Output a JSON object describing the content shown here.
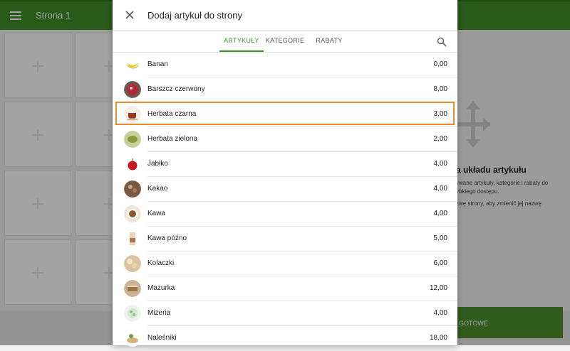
{
  "background": {
    "page_title": "Strona 1",
    "panel_title": "a układu artykułu",
    "panel_desc": "ywane artykuły, kategorie i rabaty do ybkiego dostępu.",
    "panel_hint": "zwę strony, aby zmienić jej nazwę.",
    "done_label": "GOTOWE"
  },
  "dialog": {
    "title": "Dodaj artykuł do strony",
    "tabs": [
      {
        "label": "ARTYKUŁY",
        "active": true
      },
      {
        "label": "KATEGORIE",
        "active": false
      },
      {
        "label": "RABATY",
        "active": false
      }
    ],
    "items": [
      {
        "name": "Banan",
        "price": "0,00",
        "icon": "banana-icon"
      },
      {
        "name": "Barszcz czerwony",
        "price": "8,00",
        "icon": "borscht-icon"
      },
      {
        "name": "Herbata czarna",
        "price": "3,00",
        "icon": "black-tea-icon",
        "highlighted": true
      },
      {
        "name": "Herbata zielona",
        "price": "2,00",
        "icon": "green-tea-icon"
      },
      {
        "name": "Jabłko",
        "price": "4,00",
        "icon": "apple-icon"
      },
      {
        "name": "Kakao",
        "price": "4,00",
        "icon": "cocoa-icon"
      },
      {
        "name": "Kawa",
        "price": "4,00",
        "icon": "coffee-icon"
      },
      {
        "name": "Kawa późno",
        "price": "5,00",
        "icon": "latte-icon"
      },
      {
        "name": "Kolaczki",
        "price": "6,00",
        "icon": "cookies-icon"
      },
      {
        "name": "Mazurka",
        "price": "12,00",
        "icon": "cake-icon"
      },
      {
        "name": "Mizeria",
        "price": "4,00",
        "icon": "salad-icon"
      },
      {
        "name": "Naleśniki",
        "price": "18,00",
        "icon": "pancakes-icon"
      }
    ]
  },
  "colors": {
    "brand_green": "#3f8f2a",
    "highlight_orange": "#e88a2b"
  }
}
